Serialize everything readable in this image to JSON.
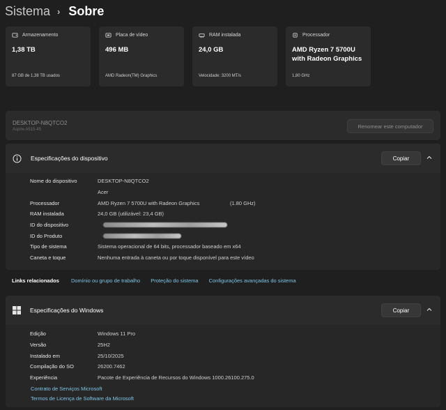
{
  "breadcrumb": {
    "parent": "Sistema",
    "current": "Sobre"
  },
  "cards": [
    {
      "icon": "storage-icon",
      "title": "Armazenamento",
      "value": "1,38 TB",
      "sub": "87 GB de 1,38 TB usados"
    },
    {
      "icon": "gpu-icon",
      "title": "Placa de vídeo",
      "value": "496 MB",
      "sub": "AMD Radeon(TM) Graphics"
    },
    {
      "icon": "ram-icon",
      "title": "RAM instalada",
      "value": "24,0 GB",
      "sub": "Velocidade: 3200 MT/s"
    },
    {
      "icon": "cpu-icon",
      "title": "Processador",
      "value": "AMD Ryzen 7 5700U with Radeon Graphics",
      "sub": "1,80 GHz"
    }
  ],
  "pc": {
    "name": "DESKTOP-N8QTCO2",
    "model": "Aspire A515-45",
    "rename_label": "Renomear este computador"
  },
  "device_specs": {
    "title": "Especificações do dispositivo",
    "copy_label": "Copiar",
    "rows": [
      {
        "label": "Nome do dispositivo",
        "value": "DESKTOP-N8QTCO2"
      },
      {
        "label": "",
        "value": "Acer"
      },
      {
        "label": "Processador",
        "value": "AMD Ryzen 7 5700U with Radeon Graphics",
        "extra": "(1.80 GHz)"
      },
      {
        "label": "RAM instalada",
        "value": "24,0 GB (utilizável: 23,4 GB)"
      },
      {
        "label": "ID do dispositivo",
        "value": ""
      },
      {
        "label": "ID do Produto",
        "value": ""
      },
      {
        "label": "Tipo de sistema",
        "value": "Sistema operacional de 64 bits, processador baseado em x64"
      },
      {
        "label": "Caneta e toque",
        "value": "Nenhuma entrada à caneta ou por toque disponível para este vídeo"
      }
    ]
  },
  "related_links": {
    "label": "Links relacionados",
    "links": [
      "Domínio ou grupo de trabalho",
      "Proteção do sistema",
      "Configurações avançadas do sistema"
    ]
  },
  "windows_specs": {
    "title": "Especificações do Windows",
    "copy_label": "Copiar",
    "rows": [
      {
        "label": "Edição",
        "value": "Windows 11 Pro"
      },
      {
        "label": "Versão",
        "value": "25H2"
      },
      {
        "label": "Instalado em",
        "value": "25/10/2025"
      },
      {
        "label": "Compilação do SO",
        "value": "26200.7462"
      },
      {
        "label": "Experiência",
        "value": "Pacote de Experiência de Recursos do Windows 1000.26100.275.0"
      }
    ],
    "links": [
      "Contrato de Serviços Microsoft",
      "Termos de Licença de Software da Microsoft"
    ]
  }
}
